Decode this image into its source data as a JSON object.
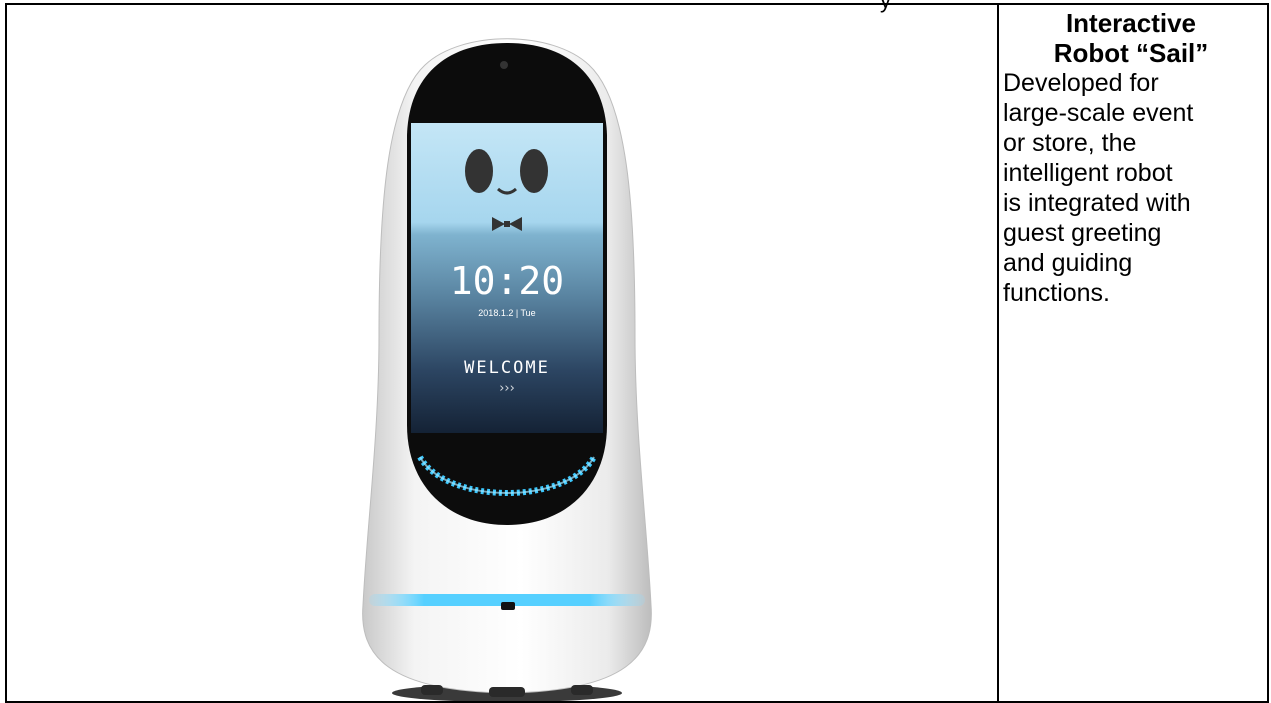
{
  "header_fragment": "y",
  "product": {
    "title_line1": "Interactive",
    "title_line2": "Robot “Sail”",
    "description_lines": [
      "Developed for",
      "large-scale event",
      "or store, the",
      "intelligent robot",
      "is integrated with",
      "guest greeting",
      "and guiding",
      "functions."
    ]
  },
  "robot_screen": {
    "time": "10:20",
    "date": "2018.1.2  |  Tue",
    "welcome": "WELCOME",
    "chevrons": "›››"
  },
  "colors": {
    "border": "#000000",
    "screen_top": "#bfe4f5",
    "screen_bottom": "#16243a",
    "led_ring": "#35c8ff",
    "robot_shell": "#f2f2f2"
  }
}
